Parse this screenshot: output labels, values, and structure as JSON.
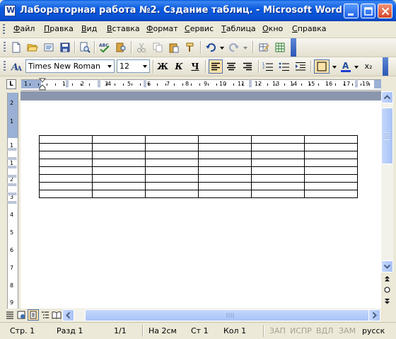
{
  "window": {
    "title": "Лабораторная работа №2. Сздание таблиц. - Microsoft Word",
    "app_icon_letter": "W"
  },
  "menu": {
    "items": [
      "Файл",
      "Правка",
      "Вид",
      "Вставка",
      "Формат",
      "Сервис",
      "Таблица",
      "Окно",
      "Справка"
    ]
  },
  "standard_toolbar": {
    "icons": [
      "new-document",
      "open-folder",
      "permission",
      "save",
      "print-preview",
      "spelling",
      "research",
      "cut",
      "copy",
      "paste",
      "format-painter",
      "undo",
      "redo",
      "table-and-borders",
      "insert-excel"
    ]
  },
  "formatting_toolbar": {
    "font_name": "Times New Roman",
    "font_size": "12",
    "bold": "Ж",
    "italic": "К",
    "underline": "Ч",
    "subscript": "x₂"
  },
  "ruler": {
    "h_numbers": [
      "1",
      "1",
      "2",
      "1",
      "3",
      "4",
      "5",
      "6",
      "7",
      "8",
      "9",
      "10",
      "11",
      "12",
      "13",
      "14",
      "15",
      "16",
      "17",
      "19"
    ],
    "v_numbers": [
      "2",
      "1",
      "1",
      "1",
      "2",
      "3",
      "4",
      "5",
      "6",
      "7",
      "8",
      "9"
    ]
  },
  "document": {
    "table": {
      "rows": 8,
      "cols": 6
    }
  },
  "status": {
    "page": "Стр. 1",
    "section": "Разд 1",
    "pages": "1/1",
    "at": "На 2см",
    "line": "Ст 1",
    "col": "Кол 1",
    "rec": "ЗАП",
    "trk": "ИСПР",
    "ext": "ВДЛ",
    "ovr": "ЗАМ",
    "lang": "русск"
  },
  "colors": {
    "titlebar": "#0a5bdc",
    "chrome": "#ece9d8",
    "doc_background": "#8a96ad",
    "pressed": "#ffe2a8"
  }
}
